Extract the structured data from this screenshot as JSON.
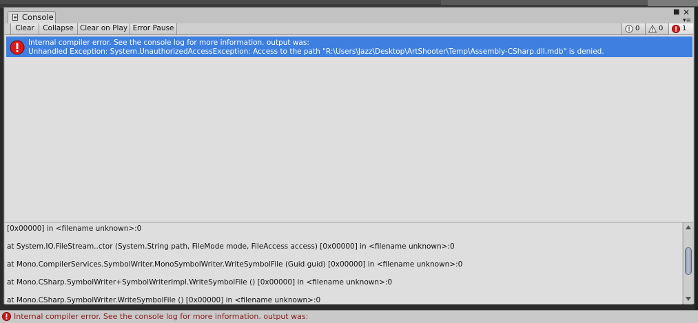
{
  "window": {
    "tab_label": "Console"
  },
  "toolbar": {
    "clear_label": "Clear",
    "collapse_label": "Collapse",
    "clear_on_play_label": "Clear on Play",
    "error_pause_label": "Error Pause"
  },
  "counters": {
    "info_count": "0",
    "warning_count": "0",
    "error_count": "1",
    "info_icon": "info-icon",
    "warning_icon": "warning-icon",
    "error_icon": "error-icon"
  },
  "log": {
    "entries": [
      {
        "type": "error",
        "line1": "Internal compiler error. See the console log for more information. output was:",
        "line2": "Unhandled Exception: System.UnauthorizedAccessException: Access to the path \"R:\\Users\\Jazz\\Desktop\\ArtShooter\\Temp\\Assembly-CSharp.dll.mdb\" is denied."
      }
    ],
    "selected_color": "#3d80df"
  },
  "detail": {
    "lines": [
      "[0x00000] in <filename unknown>:0",
      "  at System.IO.FileStream..ctor (System.String path, FileMode mode, FileAccess access) [0x00000] in <filename unknown>:0",
      "  at Mono.CompilerServices.SymbolWriter.MonoSymbolWriter.WriteSymbolFile (Guid guid) [0x00000] in <filename unknown>:0",
      "  at Mono.CSharp.SymbolWriter+SymbolWriterImpl.WriteSymbolFile () [0x00000] in <filename unknown>:0",
      "  at Mono.CSharp.SymbolWriter.WriteSymbolFile () [0x00000] in <filename unknown>:0"
    ]
  },
  "status": {
    "text": "Internal compiler error. See the console log for more information. output was:"
  }
}
